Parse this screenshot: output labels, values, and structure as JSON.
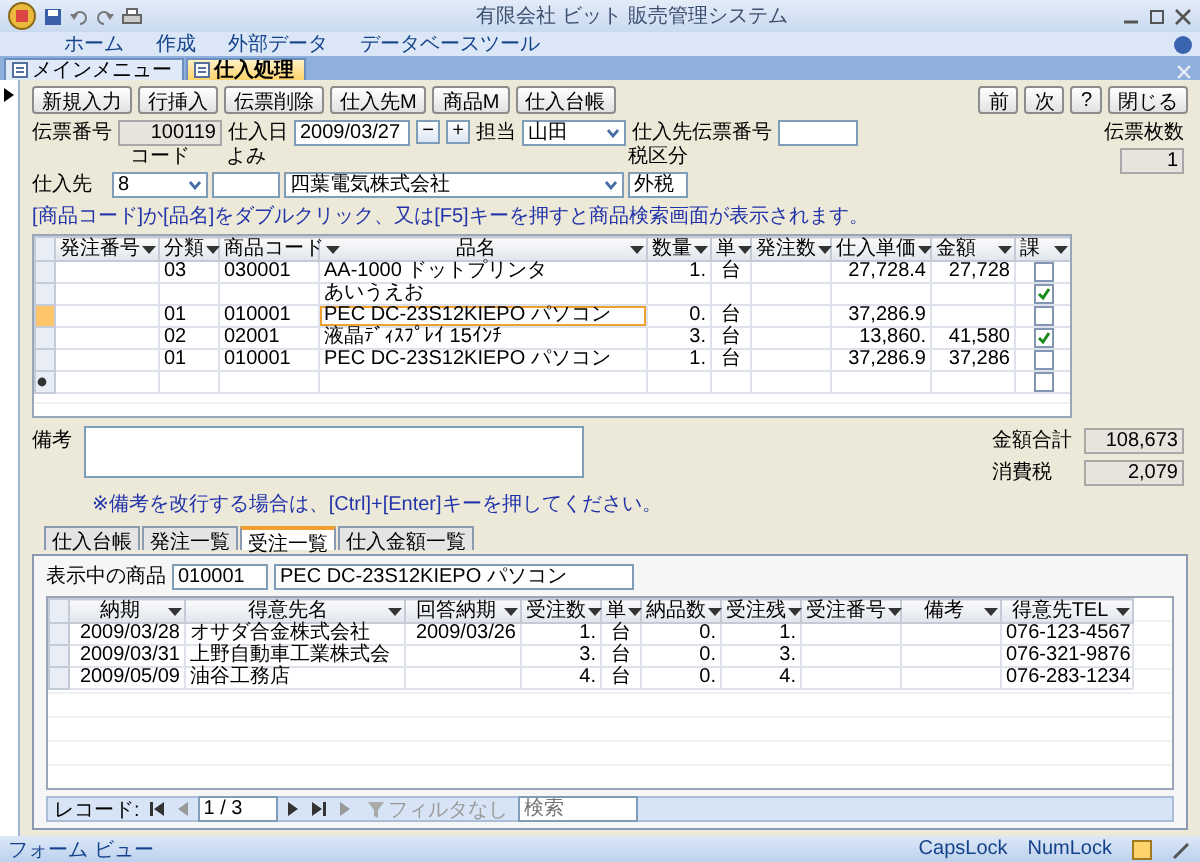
{
  "window": {
    "title": "有限会社 ビット 販売管理システム"
  },
  "ribbon_tabs": [
    "ホーム",
    "作成",
    "外部データ",
    "データベースツール"
  ],
  "doc_tabs": [
    {
      "label": "メインメニュー",
      "selected": false
    },
    {
      "label": "仕入処理",
      "selected": true
    }
  ],
  "toolbar": {
    "buttons": [
      "新規入力",
      "行挿入",
      "伝票削除",
      "仕入先M",
      "商品M",
      "仕入台帳"
    ],
    "nav_buttons": [
      "前",
      "次",
      "?",
      "閉じる"
    ]
  },
  "header": {
    "slip_number": {
      "label": "伝票番号",
      "value": "100119"
    },
    "date": {
      "label": "仕入日",
      "value": "2009/03/27",
      "minus": "−",
      "plus": "+"
    },
    "staff": {
      "label": "担当",
      "value": "山田"
    },
    "supplier_slip": {
      "label": "仕入先伝票番号"
    },
    "slip_count": {
      "label": "伝票枚数",
      "value": "1"
    }
  },
  "supplier": {
    "label": "仕入先",
    "code_label": "コード",
    "code": "8",
    "reading_label": "よみ",
    "name": "四葉電気株式会社",
    "tax_label": "税区分",
    "tax": "外税"
  },
  "hint": "[商品コード]か[品名]をダブルクリック、又は[F5]キーを押すと商品検索画面が表示されます。",
  "lines": {
    "columns": [
      "発注番号",
      "分類",
      "商品コード",
      "品名",
      "数量",
      "単",
      "発注数",
      "仕入単価",
      "金額",
      "課"
    ],
    "rows": [
      {
        "category": "03",
        "code": "030001",
        "name": "AA-1000 ドットプリンタ",
        "qty": "1.",
        "unit": "台",
        "price": "27,728.4",
        "amount": "27,728",
        "taxed": false,
        "selected": false
      },
      {
        "name": "あいうえお",
        "taxed": true,
        "selected": false
      },
      {
        "category": "01",
        "code": "010001",
        "name": "PEC  DC-23S12KIEPO  パソコン",
        "qty": "0.",
        "unit": "台",
        "price": "37,286.9",
        "taxed": false,
        "selected": true
      },
      {
        "category": "02",
        "code": "02001",
        "name": "液晶ﾃﾞｨｽﾌﾟﾚｲ 15ｲﾝﾁ",
        "qty": "3.",
        "unit": "台",
        "price": "13,860.",
        "amount": "41,580",
        "taxed": true,
        "selected": false
      },
      {
        "category": "01",
        "code": "010001",
        "name": "PEC  DC-23S12KIEPO  パソコン",
        "qty": "1.",
        "unit": "台",
        "price": "37,286.9",
        "amount": "37,286",
        "taxed": false,
        "selected": false
      }
    ],
    "new_row": {
      "taxed": false
    }
  },
  "notes": {
    "label": "備考",
    "hint": "※備考を改行する場合は、[Ctrl]+[Enter]キーを押してください。"
  },
  "totals": [
    {
      "label": "金額合計",
      "value": "108,673"
    },
    {
      "label": "消費税",
      "value": "2,079"
    }
  ],
  "sub_tabs": [
    {
      "label": "仕入台帳",
      "selected": false
    },
    {
      "label": "発注一覧",
      "selected": false
    },
    {
      "label": "受注一覧",
      "selected": true
    },
    {
      "label": "仕入金額一覧",
      "selected": false
    }
  ],
  "panel": {
    "product_label": "表示中の商品",
    "product_code": "010001",
    "product_name": "PEC  DC-23S12KIEPO  パソコン",
    "columns": [
      "納期",
      "得意先名",
      "回答納期",
      "受注数",
      "単",
      "納品数",
      "受注残",
      "受注番号",
      "備考",
      "得意先TEL"
    ],
    "rows": [
      {
        "due": "2009/03/28",
        "customer": "オサダ合金株式会社",
        "reply_due": "2009/03/26",
        "qty": "1.",
        "unit": "台",
        "delivered": "0.",
        "remaining": "1.",
        "tel": "076-123-4567"
      },
      {
        "due": "2009/03/31",
        "customer": "上野自動車工業株式会",
        "qty": "3.",
        "unit": "台",
        "delivered": "0.",
        "remaining": "3.",
        "tel": "076-321-9876"
      },
      {
        "due": "2009/05/09",
        "customer": "油谷工務店",
        "qty": "4.",
        "unit": "台",
        "delivered": "0.",
        "remaining": "4.",
        "tel": "076-283-1234"
      }
    ],
    "nav": {
      "label": "レコード:",
      "position": "1 / 3",
      "filter": "フィルタなし",
      "search_placeholder": "検索"
    }
  },
  "status_bar": {
    "view": "フォーム ビュー",
    "indicators": [
      "CapsLock",
      "NumLock"
    ]
  }
}
